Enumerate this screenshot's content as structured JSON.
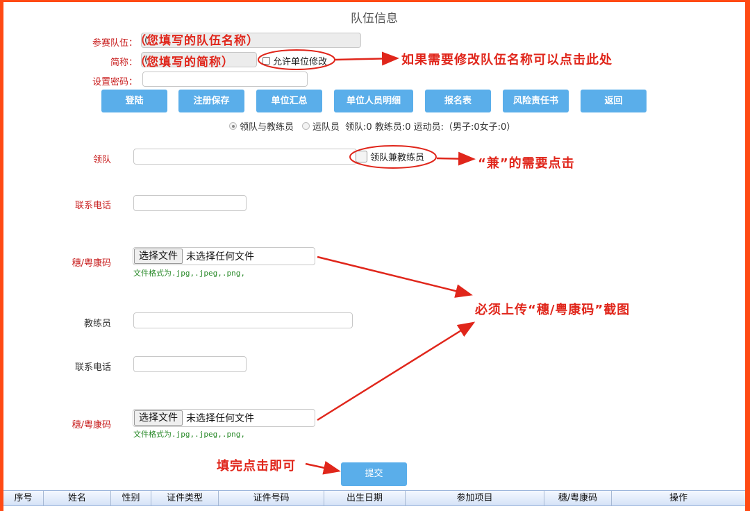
{
  "page_title": "队伍信息",
  "form": {
    "team_label": "参赛队伍：",
    "team_value": "(",
    "short_label": "简称：",
    "short_value": "(",
    "allow_modify_label": "允许单位修改",
    "password_label": "设置密码：",
    "password_value": ""
  },
  "toolbar": {
    "buttons": [
      "登陆",
      "注册保存",
      "单位汇总",
      "单位人员明细",
      "报名表",
      "风险责任书",
      "返回"
    ]
  },
  "radio": {
    "option1": "领队与教练员",
    "option2": "运队员",
    "stats": "领队:0 教练员:0 运动员:（男子:0女子:0）",
    "selected": "option1"
  },
  "leader": {
    "label": "领队",
    "value": "",
    "concurrent_label": "领队兼教练员",
    "phone_label": "联系电话",
    "phone_value": "",
    "code_label": "穗/粤康码",
    "file_button": "选择文件",
    "file_status": "未选择任何文件",
    "file_hint": "文件格式为.jpg,.jpeg,.png,"
  },
  "coach": {
    "label": "教练员",
    "value": "",
    "phone_label": "联系电话",
    "phone_value": "",
    "code_label": "穗/粤康码",
    "file_button": "选择文件",
    "file_status": "未选择任何文件",
    "file_hint": "文件格式为.jpg,.jpeg,.png,"
  },
  "submit_label": "提交",
  "table": {
    "columns": [
      "序号",
      "姓名",
      "性别",
      "证件类型",
      "证件号码",
      "出生日期",
      "参加项目",
      "穗/粤康码",
      "操作"
    ]
  },
  "annotations": {
    "team_name_hint": "（您填写的队伍名称）",
    "short_name_hint": "（您填写的简称）",
    "modify_note": "如果需要修改队伍名称可以点击此处",
    "concurrent_note": "“兼”的需要点击",
    "upload_note": "必须上传“穗/粤康码”截图",
    "submit_note": "填完点击即可"
  },
  "colors": {
    "accent": "#5aaeea",
    "annotation": "#e0261b",
    "frame": "#ff4a14",
    "required_label": "#c81e1e",
    "hint": "#2a8a2a"
  }
}
